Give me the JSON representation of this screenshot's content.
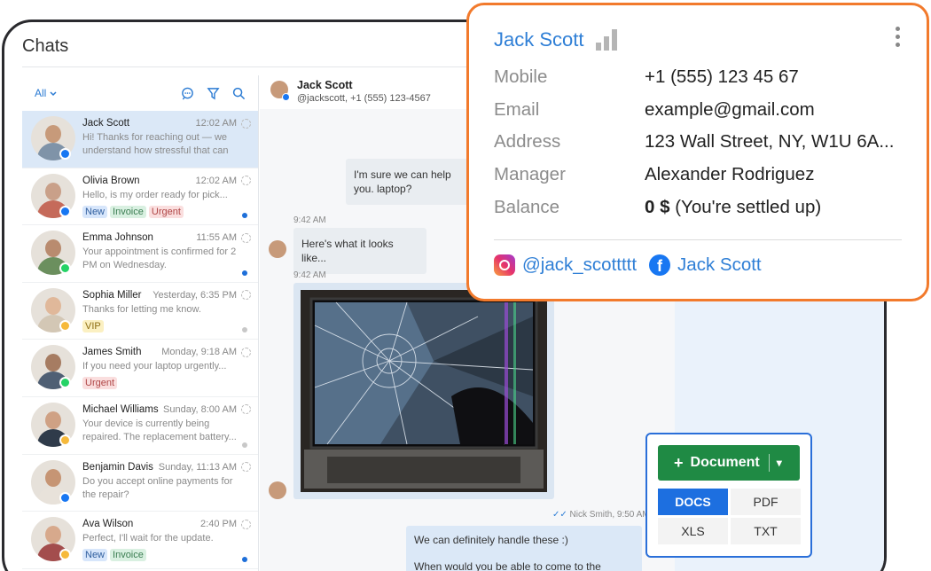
{
  "app": {
    "title": "Chats"
  },
  "filter": {
    "label": "All"
  },
  "chats": [
    {
      "name": "Jack Scott",
      "time": "12:02 AM",
      "preview": "Hi! Thanks for reaching out — we understand how stressful that can be...",
      "channel": "facebook",
      "active": true,
      "tags": []
    },
    {
      "name": "Olivia Brown",
      "time": "12:02 AM",
      "preview": "Hello, is my order ready for pick...",
      "channel": "facebook",
      "tags": [
        "New",
        "Invoice",
        "Urgent"
      ],
      "unread": true
    },
    {
      "name": "Emma Johnson",
      "time": "11:55 AM",
      "preview": "Your appointment is confirmed for 2 PM on Wednesday.",
      "channel": "whatsapp",
      "tags": [],
      "unread": true
    },
    {
      "name": "Sophia Miller",
      "time": "Yesterday, 6:35 PM",
      "preview": "Thanks for letting me know.",
      "channel": "chat",
      "tags": [
        "VIP"
      ],
      "unread": false
    },
    {
      "name": "James Smith",
      "time": "Monday, 9:18 AM",
      "preview": "If you need your laptop urgently...",
      "channel": "whatsapp",
      "tags": [
        "Urgent"
      ]
    },
    {
      "name": "Michael Williams",
      "time": "Sunday, 8:00 AM",
      "preview": "Your device is currently being repaired. The replacement battery...",
      "channel": "chat",
      "tags": [],
      "unread": false
    },
    {
      "name": "Benjamin Davis",
      "time": "Sunday, 11:13 AM",
      "preview": "Do you accept online payments for the repair?",
      "channel": "facebook",
      "tags": []
    },
    {
      "name": "Ava Wilson",
      "time": "2:40 PM",
      "preview": "Perfect, I'll wait for the update.",
      "channel": "chat",
      "tags": [
        "New",
        "Invoice"
      ],
      "unread": true
    }
  ],
  "conversation": {
    "name": "Jack Scott",
    "subtitle": "@jackscott, +1 (555) 123-4567",
    "msg1": "I'm sure we can help you. laptop?",
    "time1": "9:42 AM",
    "msg2": "Here's what it looks like...",
    "time2": "9:42 AM",
    "out_meta": "Nick Smith, 9:50 AM",
    "out_line1": "We can definitely handle these  :)",
    "out_line2": "When would you be able to come to the service?"
  },
  "contact_card": {
    "name": "Jack Scott",
    "fields": [
      {
        "label": "Mobile",
        "value": "+1 (555) 123 45 67"
      },
      {
        "label": "Email",
        "value": "example@gmail.com"
      },
      {
        "label": "Address",
        "value": "123 Wall Street, NY, W1U 6A..."
      },
      {
        "label": "Manager",
        "value": "Alexander Rodriguez"
      }
    ],
    "balance_label": "Balance",
    "balance_amount": "0 $",
    "balance_note": "(You're settled up)",
    "instagram": "@jack_scottttt",
    "facebook": "Jack Scott"
  },
  "document_widget": {
    "button": "Document",
    "formats": [
      "DOCS",
      "PDF",
      "XLS",
      "TXT"
    ],
    "selected": "DOCS"
  },
  "colors": {
    "accent": "#2f7fd6",
    "card_border": "#f27a2c",
    "document_green": "#1f8a44"
  }
}
